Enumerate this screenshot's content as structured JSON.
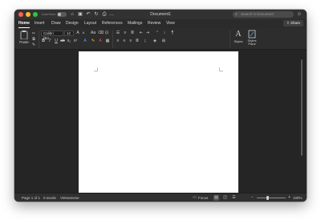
{
  "titlebar": {
    "autosave_label": "AutoSave",
    "autosave_state": "OFF",
    "title": "Document1",
    "search_placeholder": "Search in Document",
    "icons": [
      "home-icon",
      "save-icon",
      "undo-icon",
      "redo-icon",
      "print-icon",
      "more-icon",
      "smiley-icon"
    ]
  },
  "tabs": [
    {
      "label": "Home",
      "active": true
    },
    {
      "label": "Insert"
    },
    {
      "label": "Draw"
    },
    {
      "label": "Design"
    },
    {
      "label": "Layout"
    },
    {
      "label": "References"
    },
    {
      "label": "Mailings"
    },
    {
      "label": "Review"
    },
    {
      "label": "View"
    }
  ],
  "share_label": "Share",
  "ribbon": {
    "paste_label": "Paste",
    "font_name": "Calibri (Bo...",
    "font_size": "12",
    "styles_label": "Styles",
    "styles_pane_label": "Styles Pane"
  },
  "status": {
    "page": "Page 1 of 1",
    "words": "0 words",
    "language": "Vietnamese",
    "focus": "Focus",
    "zoom": "100%"
  },
  "colors": {
    "window_bg": "#2b2b2b",
    "page": "#ffffff",
    "close": "#ff5f57",
    "minimize": "#febc2e",
    "maximize": "#28c840"
  }
}
